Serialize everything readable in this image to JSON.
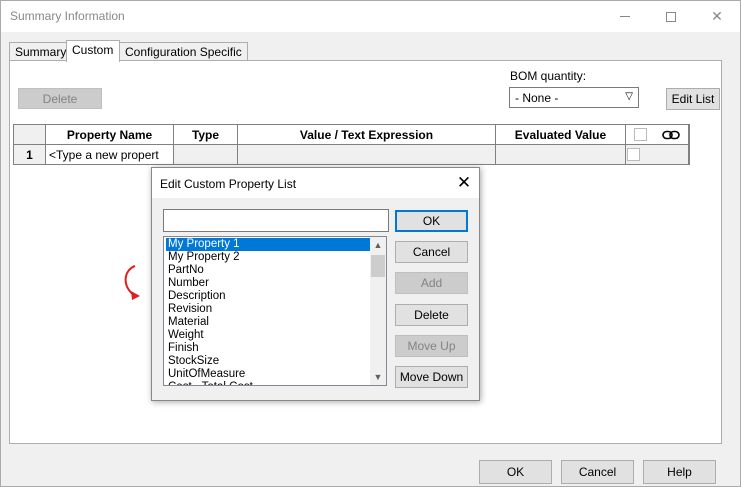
{
  "window": {
    "title": "Summary Information"
  },
  "tabs": [
    {
      "label": "Summary"
    },
    {
      "label": "Custom"
    },
    {
      "label": "Configuration Specific"
    }
  ],
  "toolbar": {
    "delete_label": "Delete",
    "bom_label": "BOM quantity:",
    "bom_value": "- None -",
    "edit_list_label": "Edit List"
  },
  "grid": {
    "headers": [
      "Property Name",
      "Type",
      "Value / Text Expression",
      "Evaluated Value"
    ],
    "rows": [
      {
        "num": "1",
        "name": "<Type a new propert",
        "type": "",
        "value": "",
        "evaluated": ""
      }
    ]
  },
  "dialog": {
    "title": "Edit Custom Property List",
    "input_value": "",
    "items": [
      "My Property 1",
      "My Property 2",
      "PartNo",
      "Number",
      "Description",
      "Revision",
      "Material",
      "Weight",
      "Finish",
      "StockSize",
      "UnitOfMeasure",
      "Cost - Total Cost"
    ],
    "selected_index": 0,
    "buttons": {
      "ok": "OK",
      "cancel": "Cancel",
      "add": "Add",
      "delete": "Delete",
      "move_up": "Move Up",
      "move_down": "Move Down"
    }
  },
  "footer": {
    "ok": "OK",
    "cancel": "Cancel",
    "help": "Help"
  },
  "colors": {
    "selection": "#0078d7",
    "annotation_arrow": "#e02020"
  }
}
